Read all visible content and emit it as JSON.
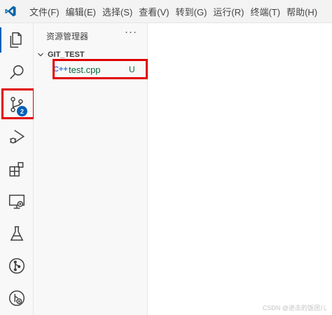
{
  "menu": [
    "文件(F)",
    "编辑(E)",
    "选择(S)",
    "查看(V)",
    "转到(G)",
    "运行(R)",
    "终端(T)",
    "帮助(H)"
  ],
  "activity_bar": {
    "items": [
      "explorer-icon",
      "search-icon",
      "source-control-icon",
      "run-debug-icon",
      "extensions-icon",
      "remote-explorer-icon",
      "testing-icon",
      "git-graph-icon",
      "gitlens-icon"
    ],
    "active": "explorer-icon",
    "source_control_badge": "2"
  },
  "explorer": {
    "title": "资源管理器",
    "more": "···",
    "section": "GIT_TEST",
    "files": [
      {
        "icon": "C++",
        "name": "test.cpp",
        "status": "U"
      }
    ]
  },
  "watermark": "CSDN @进击的饭团儿",
  "colors": {
    "accent": "#005fb8",
    "highlight": "#e10000",
    "untracked": "#0b6a3e",
    "cpp_icon": "#3c78d8"
  }
}
